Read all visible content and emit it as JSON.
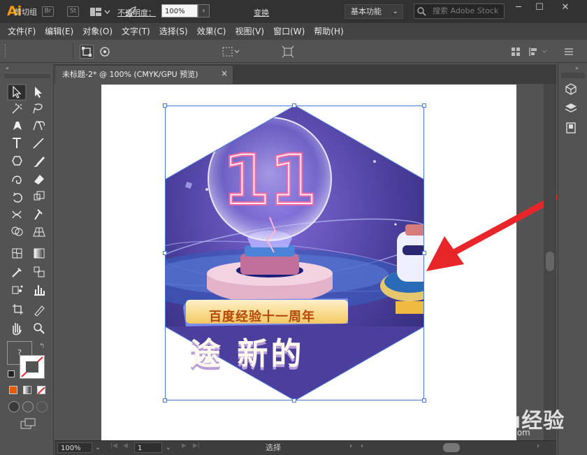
{
  "app": {
    "logo": "Ai",
    "bridge_label": "Br",
    "stock_label": "St",
    "workspace": "基本功能",
    "search_placeholder": "搜索 Adobe Stock"
  },
  "menu": [
    "文件(F)",
    "编辑(E)",
    "对象(O)",
    "文字(T)",
    "选择(S)",
    "效果(C)",
    "视图(V)",
    "窗口(W)",
    "帮助(H)"
  ],
  "control": {
    "selection_name": "剪切组",
    "opacity_label": "不透明度：",
    "opacity_value": "100%",
    "transform_label": "变换"
  },
  "document": {
    "tab_title": "未标题-2* @ 100% (CMYK/GPU 预览)",
    "close": "×"
  },
  "artwork": {
    "bulb_number": "11",
    "banner_text": "百度经验十一周年",
    "big_text": "途 新的"
  },
  "status": {
    "zoom": "100%",
    "page": "1",
    "mode_text": "选择"
  },
  "watermark": {
    "text": "Baidu经验",
    "url": "jingyan.baidu.com"
  },
  "tool_color": {
    "fill_placeholder": "?",
    "accent": "#ff9a00",
    "arrow": "#e8262a",
    "selection": "#4a77d4"
  },
  "tools": [
    "selection-tool",
    "direct-selection-tool",
    "magic-wand-tool",
    "lasso-tool",
    "pen-tool",
    "curvature-tool",
    "type-tool",
    "line-tool",
    "polygon-tool",
    "paintbrush-tool",
    "shaper-tool",
    "eraser-tool",
    "rotate-tool",
    "scale-tool",
    "width-tool",
    "puppet-warp-tool",
    "shape-builder-tool",
    "perspective-grid-tool",
    "mesh-tool",
    "gradient-tool",
    "eyedropper-tool",
    "blend-tool",
    "symbol-sprayer-tool",
    "column-graph-tool",
    "artboard-tool",
    "slice-tool",
    "hand-tool",
    "zoom-tool"
  ]
}
